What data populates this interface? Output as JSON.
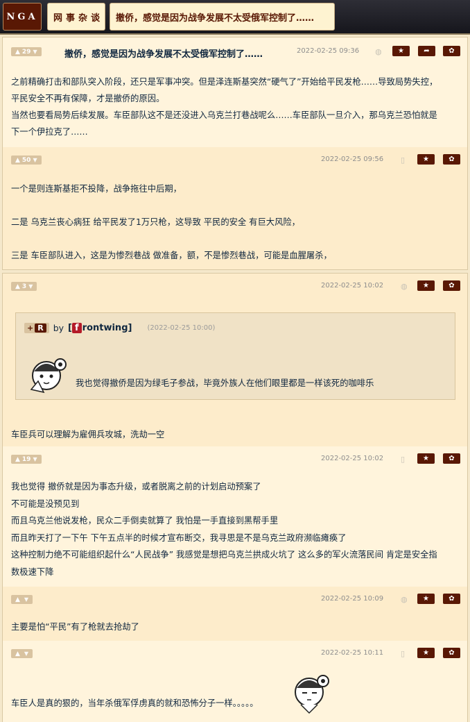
{
  "header": {
    "logo": "NGA",
    "forum": "网事杂谈",
    "thread_title": "撤侨，感觉是因为战争发展不太受俄军控制了……"
  },
  "icons": {
    "star": "★",
    "share": "➦",
    "gear": "✿",
    "thumb_up": "👍",
    "thumb_down": "👎",
    "android": "android-icon",
    "phone": "phone-icon"
  },
  "posts": [
    {
      "votes": "29",
      "title": "撤侨，感觉是因为战争发展不太受俄军控制了……",
      "date": "2022-02-25 09:36",
      "lines": [
        "之前精确打击和部队突入阶段，还只是军事冲突。但是泽连斯基突然“硬气了”开始给平民发枪……导致局势失控，",
        "平民安全不再有保障，才是撤侨的原因。",
        "当然也要看局势后续发展。车臣部队这不是还没进入乌克兰打巷战呢么……车臣部队一旦介入，那乌克兰恐怕就是",
        "下一个伊拉克了……"
      ]
    },
    {
      "votes": "50",
      "date": "2022-02-25 09:56",
      "lines": [
        "一个是则连斯基拒不投降，战争拖往中后期，",
        "",
        "二是 乌克兰丧心病狂 给平民发了1万只枪，这导致 平民的安全 有巨大风险，",
        "",
        "三是 车臣部队进入，这是为惨烈巷战 做准备，额，不是惨烈巷战，可能是血腥屠杀，"
      ]
    },
    {
      "votes": "3",
      "date": "2022-02-25 10:02",
      "quote": {
        "plus": "+",
        "r": "R",
        "by": "by",
        "user_prefix": "[",
        "user_initial": "f",
        "user_rest": "rontwing]",
        "date": "(2022-02-25 10:00)",
        "text": "我也觉得撤侨是因为绿毛子参战，毕竟外族人在他们眼里都是一样该死的咖啡乐"
      },
      "lines": [
        "车臣兵可以理解为雇佣兵攻城，洗劫一空"
      ]
    },
    {
      "votes": "19",
      "date": "2022-02-25 10:02",
      "lines": [
        "我也觉得 撤侨就是因为事态升级，或者脱离之前的计划启动预案了",
        "不可能是没预见到",
        "而且乌克兰他说发枪，民众二手倒卖就算了 我怕是一手直接到黑帮手里",
        "而且昨天打了一下午 下午五点半的时候才宣布断交，我寻思是不是乌克兰政府濒临瘫痪了",
        "这种控制力绝不可能组织起什么“人民战争” 我感觉是想把乌克兰拱成火坑了 这么多的军火流落民间 肯定是安全指",
        "数极速下降"
      ]
    },
    {
      "votes": "",
      "date": "2022-02-25 10:09",
      "lines": [
        "主要是怕“平民”有了枪就去抢劫了"
      ]
    },
    {
      "votes": "",
      "date": "2022-02-25 10:11",
      "lines": [
        "车臣人是真的狠的，当年杀俄军俘虏真的就和恐怖分子一样。。。。。"
      ]
    }
  ]
}
